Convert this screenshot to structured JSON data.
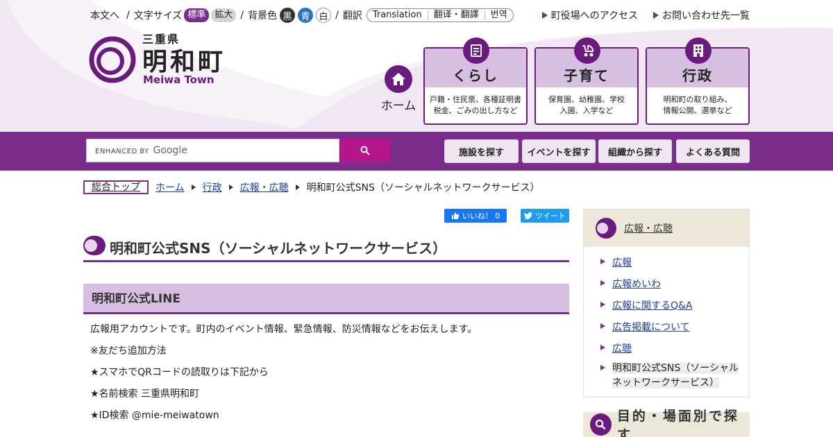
{
  "utility": {
    "skip": "本文へ",
    "font_size_label": "文字サイズ",
    "font_standard": "標準",
    "font_large": "拡大",
    "bg_label": "背景色",
    "bg_black": "黒",
    "bg_blue": "青",
    "bg_white": "白",
    "translate_label": "翻訳",
    "translate_options": [
      "Translation",
      "翻译・翻譯",
      "번역"
    ],
    "access_link": "町役場へのアクセス",
    "contact_link": "お問い合わせ先一覧"
  },
  "logo": {
    "prefecture": "三重県",
    "town_name": "明和町",
    "town_name_en": "Meiwa Town"
  },
  "nav": {
    "home_label": "ホーム",
    "tiles": [
      {
        "title": "くらし",
        "desc1": "戸籍・住民票、各種証明書",
        "desc2": "税金、ごみの出し方など",
        "icon": "document-icon"
      },
      {
        "title": "子育て",
        "desc1": "保育園、幼稚園、学校",
        "desc2": "入園、入学など",
        "icon": "stroller-icon"
      },
      {
        "title": "行政",
        "desc1": "明和町の取り組み、",
        "desc2": "情報公開、選挙など",
        "icon": "building-icon"
      }
    ]
  },
  "search": {
    "enhanced_by": "ENHANCED BY",
    "google": "Google",
    "quick_buttons": [
      "施設を探す",
      "イベントを探す",
      "組織から探す",
      "よくある質問"
    ]
  },
  "breadcrumb": {
    "top": "総合トップ",
    "items": [
      "ホーム",
      "行政",
      "広報・広聴"
    ],
    "current": "明和町公式SNS（ソーシャルネットワークサービス）"
  },
  "social": {
    "like": "いいね！ 0",
    "tweet": "ツイート"
  },
  "main": {
    "title": "明和町公式SNS（ソーシャルネットワークサービス）",
    "section_title": "明和町公式LINE",
    "paragraphs": [
      "広報用アカウントです。町内のイベント情報、緊急情報、防災情報などをお伝えします。",
      "※友だち追加方法",
      "★スマホでQRコードの読取りは下記から",
      "★名前検索 三重県明和町",
      "★ID検索 @mie-meiwatown"
    ]
  },
  "side": {
    "heading": "広報・広聴",
    "items": [
      "広報",
      "広報めいわ",
      "広報に関するQ&A",
      "広告掲載について",
      "広聴"
    ],
    "current_line1": "明和町公式SNS（ソーシャル",
    "current_line2": "ネットワークサービス）",
    "purpose_heading": "目的・場面別で探す"
  },
  "colors": {
    "brand_purple": "#7b2d8b",
    "dark_purple": "#6a1b7d",
    "light_purple": "#d6bfe0",
    "search_button": "#b5168c"
  }
}
